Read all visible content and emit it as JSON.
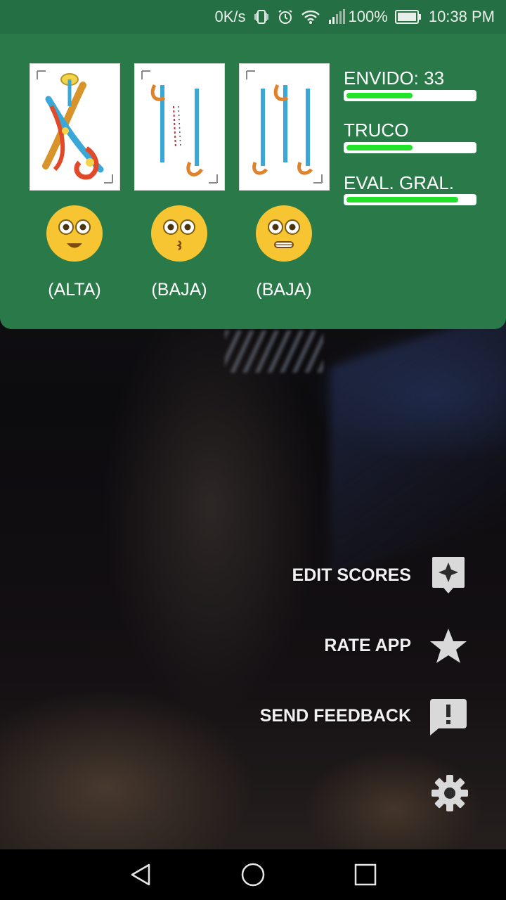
{
  "status_bar": {
    "net_speed": "0K/s",
    "battery": "100%",
    "time": "10:38 PM"
  },
  "cards": [
    {
      "name": "card-espadas-10"
    },
    {
      "name": "card-espadas-2"
    },
    {
      "name": "card-espadas-3"
    }
  ],
  "hands": [
    {
      "label": "(ALTA)",
      "emoji": "smiling-face-icon"
    },
    {
      "label": "(BAJA)",
      "emoji": "kissing-face-icon"
    },
    {
      "label": "(BAJA)",
      "emoji": "grimacing-face-icon"
    }
  ],
  "stats": {
    "envido": {
      "label": "ENVIDO: 33",
      "level": 0.52
    },
    "truco": {
      "label": "TRUCO",
      "level": 0.52
    },
    "general": {
      "label": "EVAL. GRAL.",
      "level": 0.88
    }
  },
  "menu": {
    "edit_scores": "EDIT SCORES",
    "rate_app": "RATE APP",
    "send_feedback": "SEND FEEDBACK"
  },
  "colors": {
    "panel": "#2a7a49",
    "status_bar": "#256f45",
    "bar_fill": "#22e32a"
  }
}
